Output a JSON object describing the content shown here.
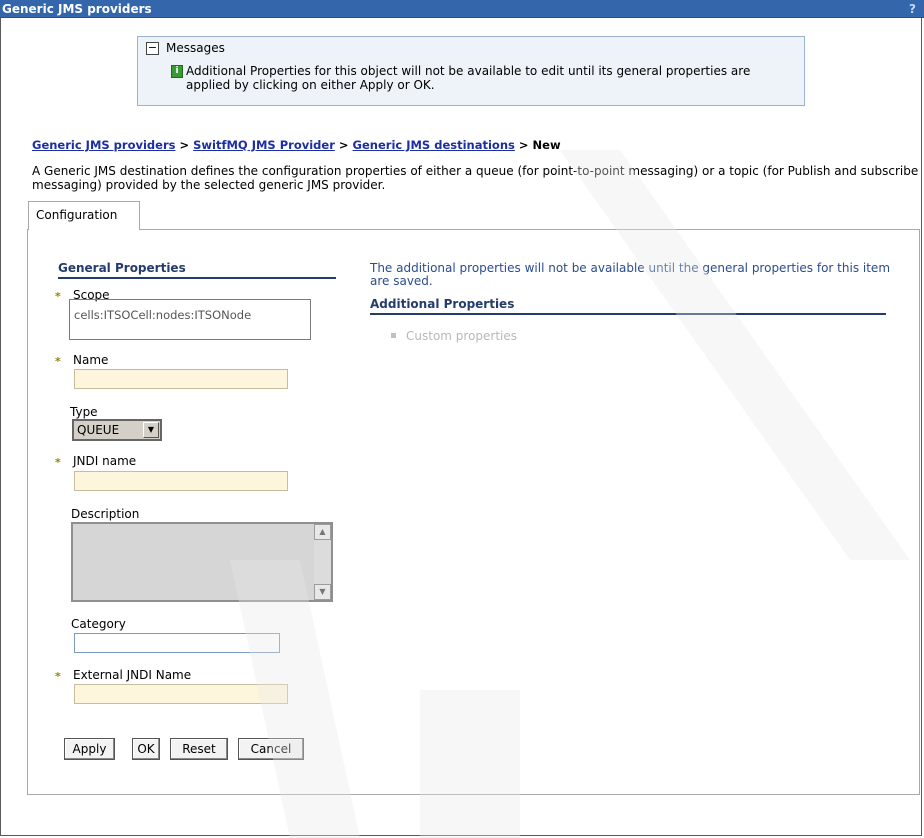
{
  "window": {
    "title": "Generic JMS providers",
    "help": "?"
  },
  "messages": {
    "title": "Messages",
    "text": "Additional Properties for this object will not be available to edit until its general properties are applied by clicking on either Apply or OK."
  },
  "breadcrumb": {
    "links": [
      "Generic JMS providers",
      "SwitfMQ JMS Provider",
      "Generic JMS destinations"
    ],
    "separator": ">",
    "current": "New"
  },
  "description": "A Generic JMS destination defines the configuration properties of either a queue (for point-to-point messaging) or a topic (for Publish and subscribe messaging) provided by the selected generic JMS provider.",
  "tabs": {
    "configuration": "Configuration"
  },
  "general": {
    "title": "General Properties",
    "scope_label": "Scope",
    "scope_value": "cells:ITSOCell:nodes:ITSONode",
    "name_label": "Name",
    "name_value": "",
    "type_label": "Type",
    "type_value": "QUEUE",
    "jndi_label": "JNDI name",
    "jndi_value": "",
    "description_label": "Description",
    "category_label": "Category",
    "ext_jndi_label": "External JNDI Name",
    "required_marker": "*"
  },
  "additional": {
    "note": "The additional properties will not be available until the general properties for this item are saved.",
    "title": "Additional Properties",
    "items": [
      "Custom properties"
    ]
  },
  "buttons": {
    "apply": "Apply",
    "ok": "OK",
    "reset": "Reset",
    "cancel": "Cancel"
  },
  "colors": {
    "titlebar": "#3366aa",
    "link": "#1b2ea6",
    "section": "#243c6c",
    "required": "#9a8400"
  }
}
